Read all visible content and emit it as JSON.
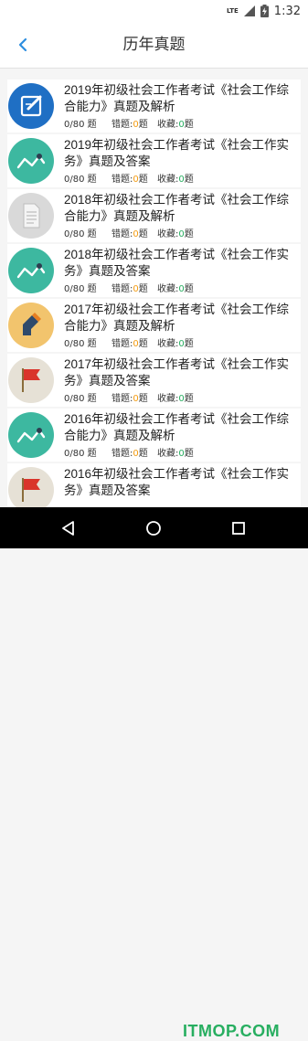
{
  "status_bar": {
    "network": "LTE",
    "time": "1:32"
  },
  "header": {
    "title": "历年真题"
  },
  "labels": {
    "count_suffix": "题",
    "wrong_label": "错题:",
    "fav_label": "收藏:",
    "unit": "题"
  },
  "colors": {
    "wrong_number": "#f39c12",
    "fav_number": "#27ae60"
  },
  "exams": [
    {
      "icon": "edit-icon",
      "title": "2019年初级社会工作者考试《社会工作综合能力》真题及解析",
      "progress": "0/80",
      "wrong": "0",
      "fav": "0"
    },
    {
      "icon": "trend-icon",
      "title": "2019年初级社会工作者考试《社会工作实务》真题及答案",
      "progress": "0/80",
      "wrong": "0",
      "fav": "0"
    },
    {
      "icon": "document-icon",
      "title": "2018年初级社会工作者考试《社会工作综合能力》真题及解析",
      "progress": "0/80",
      "wrong": "0",
      "fav": "0"
    },
    {
      "icon": "trend-icon",
      "title": " 2018年初级社会工作者考试《社会工作实务》真题及答案",
      "progress": "0/80",
      "wrong": "0",
      "fav": "0"
    },
    {
      "icon": "ruler-icon",
      "title": "2017年初级社会工作者考试《社会工作综合能力》真题及解析",
      "progress": "0/80",
      "wrong": "0",
      "fav": "0"
    },
    {
      "icon": "flag-icon",
      "title": "2017年初级社会工作者考试《社会工作实务》真题及答案",
      "progress": "0/80",
      "wrong": "0",
      "fav": "0"
    },
    {
      "icon": "trend-icon",
      "title": "2016年初级社会工作者考试《社会工作综合能力》真题及解析",
      "progress": "0/80",
      "wrong": "0",
      "fav": "0"
    },
    {
      "icon": "flag-icon",
      "title": "2016年初级社会工作者考试《社会工作实务》真题及答案",
      "progress": "",
      "wrong": "",
      "fav": ""
    }
  ],
  "watermark": "ITMOP.COM"
}
